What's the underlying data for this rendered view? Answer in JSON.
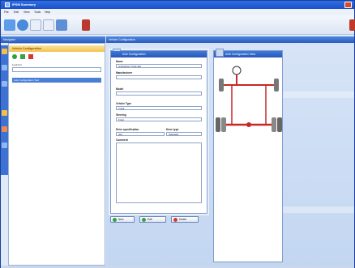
{
  "window": {
    "title": "IPSM Summary"
  },
  "menu": {
    "items": [
      "File",
      "Edit",
      "View",
      "Tools",
      "Help"
    ]
  },
  "panels": {
    "left_title": "Navigator",
    "main_title": "Vehicle Configuration"
  },
  "left": {
    "section_title": "Vehicle Configuration",
    "field_label": "Look For",
    "list_item": "Axle Configuration Tool"
  },
  "properties": {
    "title": "Axle Configuration",
    "fields": [
      {
        "label": "Name",
        "value": "Unitraction Truck 2ax"
      },
      {
        "label": "Manufacturer",
        "value": ""
      },
      {
        "label": "Model",
        "value": ""
      },
      {
        "label": "Vehicle Type",
        "value": "Truck"
      },
      {
        "label": "Steering",
        "value": "Front"
      },
      {
        "label": "Drive specification",
        "value": "4x2"
      },
      {
        "label": "Drive type",
        "value": "Standard"
      },
      {
        "label": "Comment",
        "value": ""
      }
    ]
  },
  "diagram": {
    "title": "Axle Configuration View"
  },
  "buttons": {
    "ok": "New",
    "edit": "Edit",
    "delete": "Delete"
  },
  "colors": {
    "accent": "#2b5dbf",
    "axle": "#c62828",
    "highlight": "#f3c24e"
  }
}
